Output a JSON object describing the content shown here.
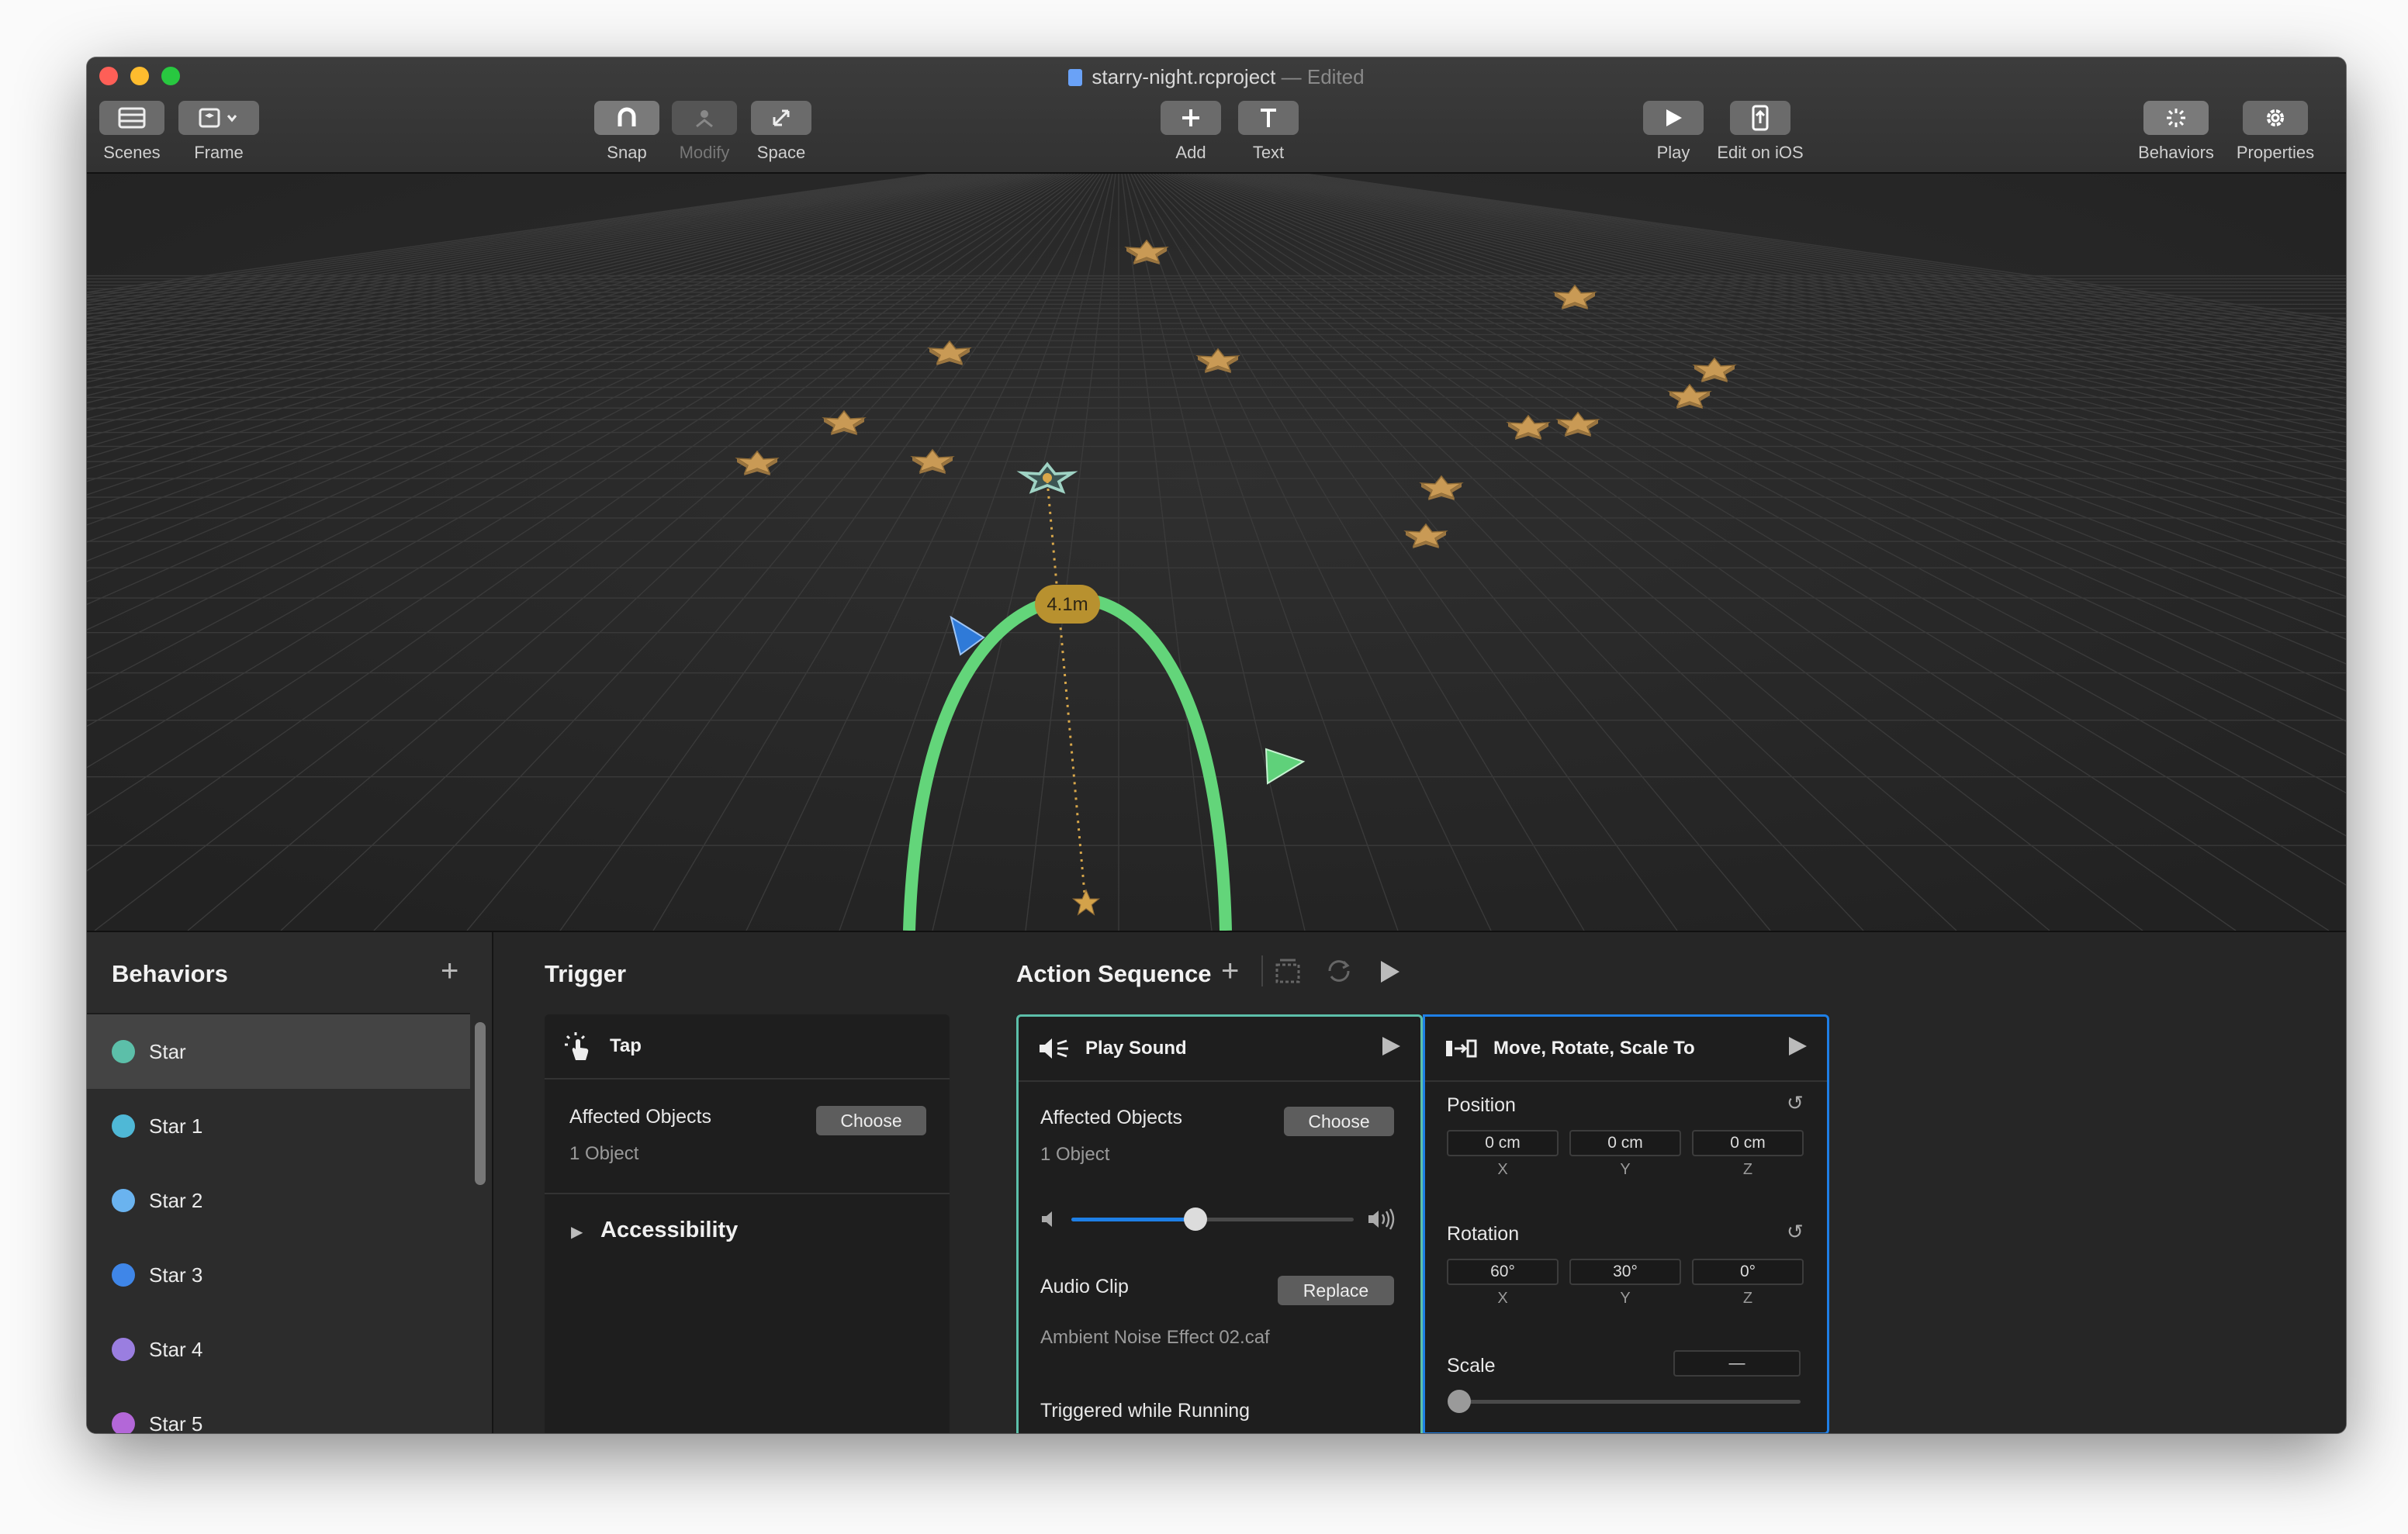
{
  "window": {
    "title": "starry-night.rcproject",
    "status": "— Edited"
  },
  "toolbar": {
    "scenes": "Scenes",
    "frame": "Frame",
    "snap": "Snap",
    "modify": "Modify",
    "space": "Space",
    "add": "Add",
    "text": "Text",
    "play": "Play",
    "edit_on_ios": "Edit on iOS",
    "behaviors": "Behaviors",
    "properties": "Properties"
  },
  "viewport": {
    "distance_label": "4.1m"
  },
  "behaviors": {
    "title": "Behaviors",
    "items": [
      {
        "label": "Star",
        "color": "#5cbfa9",
        "selected": true
      },
      {
        "label": "Star 1",
        "color": "#4fb8d6"
      },
      {
        "label": "Star 2",
        "color": "#6ab3ef"
      },
      {
        "label": "Star 3",
        "color": "#3f86e8"
      },
      {
        "label": "Star 4",
        "color": "#9a7ee0"
      },
      {
        "label": "Star 5",
        "color": "#b367d8"
      }
    ]
  },
  "trigger": {
    "title": "Trigger",
    "card_title": "Tap",
    "affected_label": "Affected Objects",
    "affected_value": "1 Object",
    "choose": "Choose",
    "accessibility": "Accessibility"
  },
  "action_sequence": {
    "title": "Action Sequence",
    "play_sound": {
      "title": "Play Sound",
      "affected_label": "Affected Objects",
      "affected_value": "1 Object",
      "choose": "Choose",
      "volume": 0.44,
      "audio_clip_label": "Audio Clip",
      "replace": "Replace",
      "clip_name": "Ambient Noise Effect 02.caf",
      "triggered_label": "Triggered while Running"
    },
    "transform": {
      "title": "Move, Rotate, Scale To",
      "position_label": "Position",
      "position": {
        "x": "0 cm",
        "y": "0 cm",
        "z": "0 cm"
      },
      "rotation_label": "Rotation",
      "rotation": {
        "x": "60°",
        "y": "30°",
        "z": "0°"
      },
      "axis_x": "X",
      "axis_y": "Y",
      "axis_z": "Z",
      "scale_label": "Scale",
      "scale_value": "—",
      "scale_slider": 0.0
    }
  },
  "colors": {
    "accent_blue": "#1e7fe6",
    "accent_teal": "#5cbfa9",
    "ring_green": "#63d57a",
    "star_gold": "#c99a55"
  }
}
